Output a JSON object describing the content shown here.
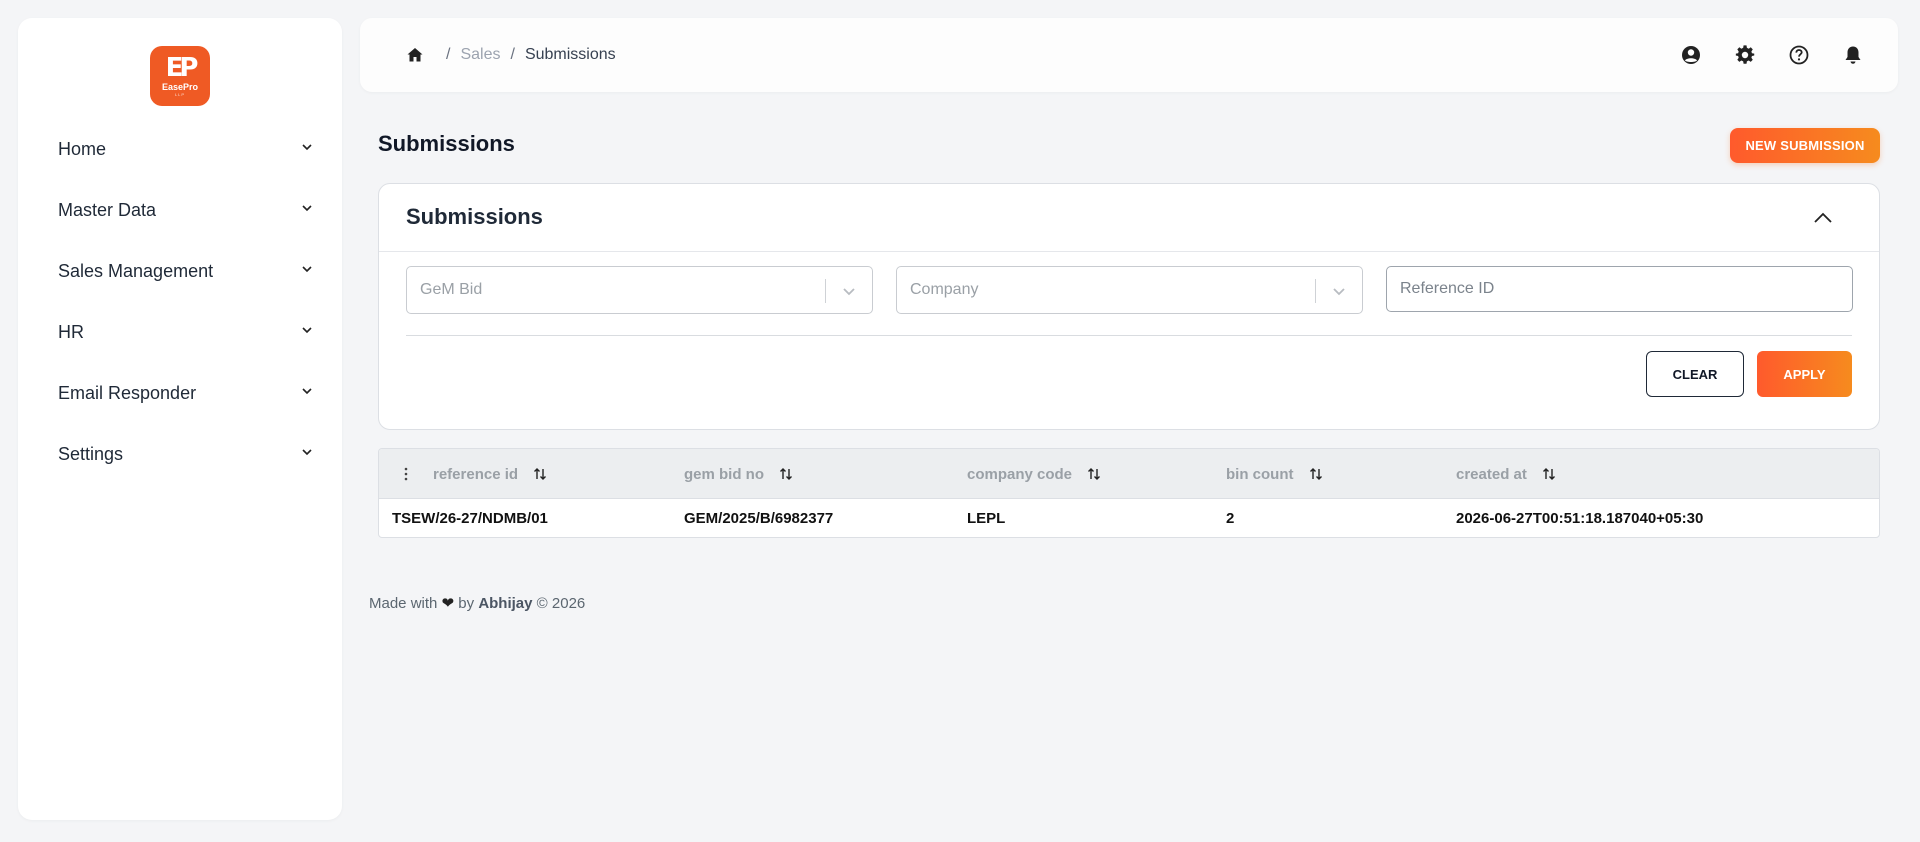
{
  "app": {
    "logo_text": "EasePro",
    "logo_sub": "LLP",
    "logo_mark": "EP"
  },
  "sidebar": {
    "items": [
      {
        "label": "Home"
      },
      {
        "label": "Master Data"
      },
      {
        "label": "Sales Management"
      },
      {
        "label": "HR"
      },
      {
        "label": "Email Responder"
      },
      {
        "label": "Settings"
      }
    ]
  },
  "breadcrumb": {
    "sep": "/",
    "parent": "Sales",
    "current": "Submissions"
  },
  "page": {
    "title": "Submissions",
    "new_button": "NEW SUBMISSION"
  },
  "filters": {
    "title": "Submissions",
    "gem_bid_placeholder": "GeM Bid",
    "company_placeholder": "Company",
    "reference_placeholder": "Reference ID",
    "clear_label": "CLEAR",
    "apply_label": "APPLY"
  },
  "table": {
    "columns": [
      "reference id",
      "gem bid no",
      "company code",
      "bin count",
      "created at"
    ],
    "rows": [
      [
        "TSEW/26-27/NDMB/01",
        "GEM/2025/B/6982377",
        "LEPL",
        "2",
        "2026-06-27T00:51:18.187040+05:30"
      ]
    ]
  },
  "footer": {
    "made_with": "Made with",
    "by": "by",
    "author": "Abhijay",
    "copyright": "© 2026",
    "heart": "❤"
  },
  "colors": {
    "accent_start": "#ff5a2c",
    "accent_end": "#f68b1e",
    "logo_bg": "#ef5a24"
  }
}
